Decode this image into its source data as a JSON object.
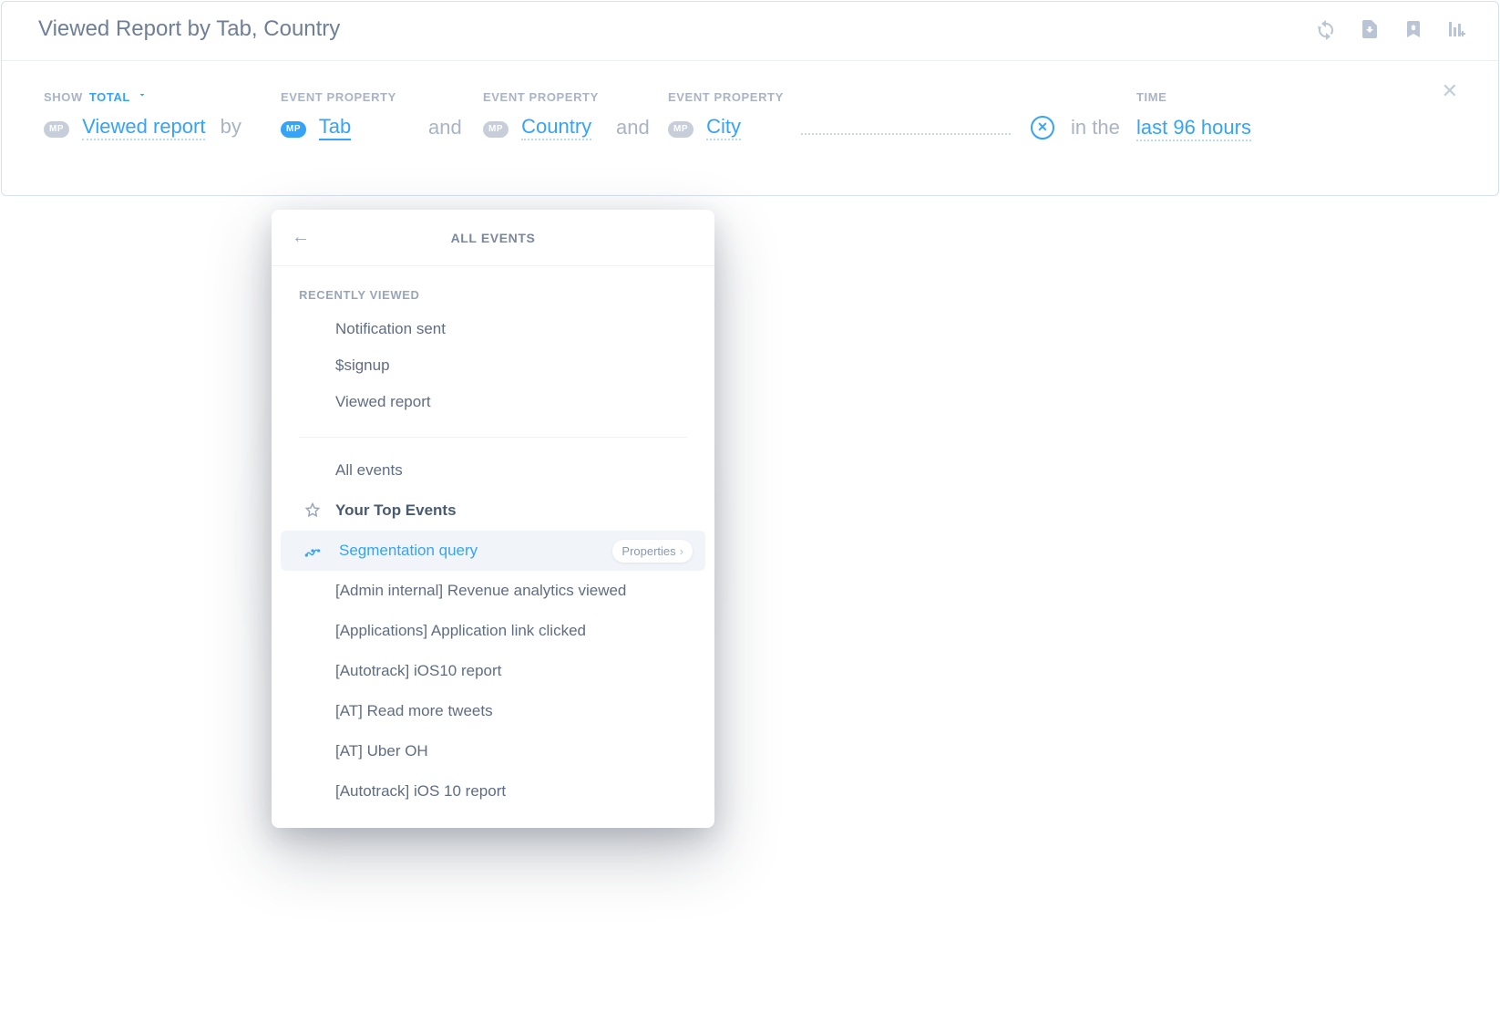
{
  "colors": {
    "accent": "#36a3f7",
    "muted": "#aab4c4",
    "text": "#5f6d82"
  },
  "header": {
    "title": "Viewed Report by Tab, Country"
  },
  "labels": {
    "show": "SHOW",
    "total": "TOTAL",
    "event_property": "EVENT PROPERTY",
    "time": "TIME"
  },
  "chip": {
    "mp": "MP"
  },
  "query": {
    "event": "Viewed report",
    "by_word": "by",
    "properties": [
      "Tab",
      "Country",
      "City"
    ],
    "and_word": "and",
    "in_the_word": "in the",
    "time": "last 96 hours"
  },
  "dropdown": {
    "title": "ALL EVENTS",
    "recently_viewed_label": "RECENTLY VIEWED",
    "recently_viewed": [
      "Notification sent",
      "$signup",
      "Viewed report"
    ],
    "all_events": "All events",
    "your_top_events": "Your Top Events",
    "selected": {
      "label": "Segmentation query",
      "pill": "Properties"
    },
    "items": [
      "[Admin internal] Revenue analytics viewed",
      "[Applications] Application link clicked",
      "[Autotrack] iOS10 report",
      "[AT] Read more tweets",
      "[AT] Uber OH",
      "[Autotrack] iOS 10 report"
    ]
  }
}
